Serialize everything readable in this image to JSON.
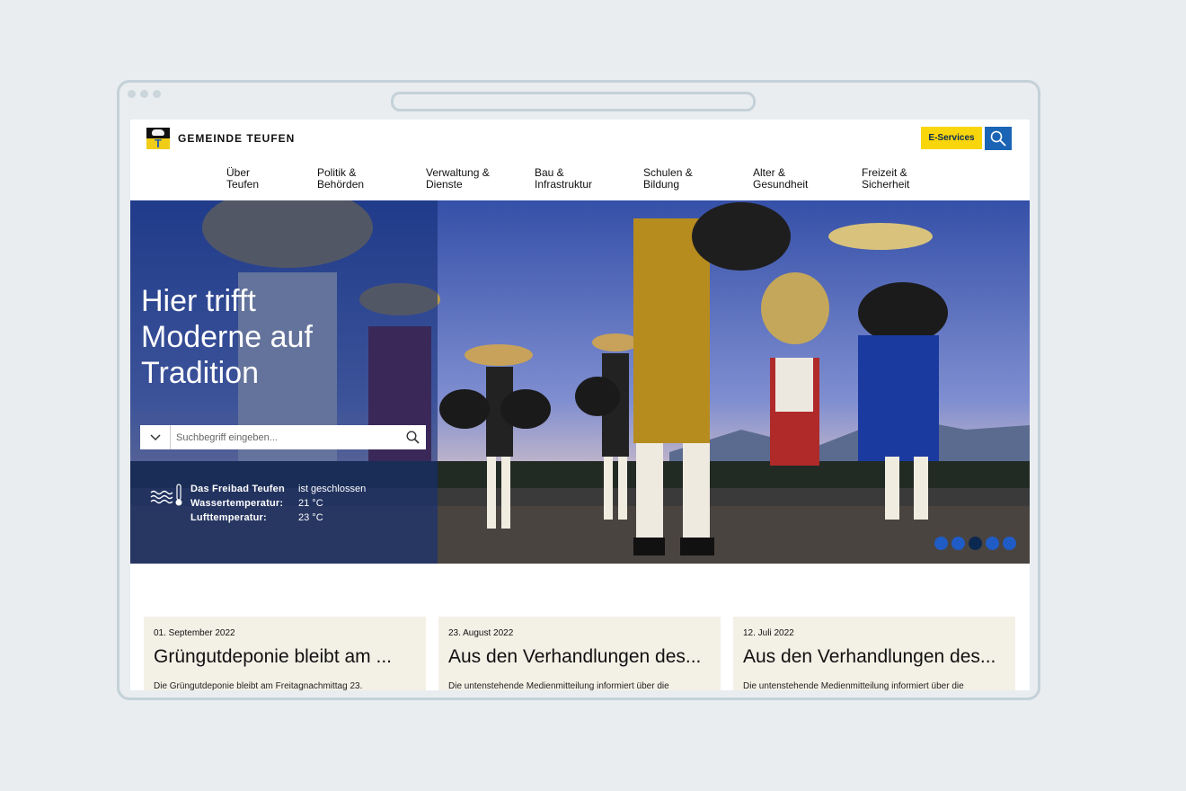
{
  "site": {
    "name": "GEMEINDE TEUFEN",
    "logo_icon": "bear-coat-of-arms-icon"
  },
  "header": {
    "eservices_label": "E-Services",
    "search_icon": "search-icon"
  },
  "nav": [
    {
      "label": "Über\nTeufen"
    },
    {
      "label": "Politik &\nBehörden"
    },
    {
      "label": "Verwaltung &\nDienste"
    },
    {
      "label": "Bau &\nInfrastruktur"
    },
    {
      "label": "Schulen &\nBildung"
    },
    {
      "label": "Alter &\nGesundheit"
    },
    {
      "label": "Freizeit &\nSicherheit"
    }
  ],
  "hero": {
    "headline": "Hier trifft\nModerne auf\nTradition",
    "search_placeholder": "Suchbegriff eingeben...",
    "pool": {
      "name": "Das Freibad Teufen",
      "status": "ist geschlossen",
      "water_label": "Wassertemperatur:",
      "water_value": "21 °C",
      "air_label": "Lufttemperatur:",
      "air_value": "23 °C",
      "icon": "water-thermometer-icon"
    },
    "carousel": {
      "count": 5,
      "active": 3
    }
  },
  "news": [
    {
      "date": "01. September 2022",
      "title": "Grüngutdeponie bleibt am ...",
      "excerpt": "Die Grüngutdeponie bleibt am Freitagnachmittag 23."
    },
    {
      "date": "23. August 2022",
      "title": "Aus den Verhandlungen des...",
      "excerpt": "Die untenstehende Medienmitteilung informiert über die"
    },
    {
      "date": "12. Juli 2022",
      "title": "Aus den Verhandlungen des...",
      "excerpt": "Die untenstehende Medienmitteilung informiert über die"
    }
  ],
  "colors": {
    "accent_yellow": "#f9d50b",
    "accent_blue": "#1b64b5",
    "panel_blue": "#142f78",
    "card_bg": "#f3f0e6"
  }
}
